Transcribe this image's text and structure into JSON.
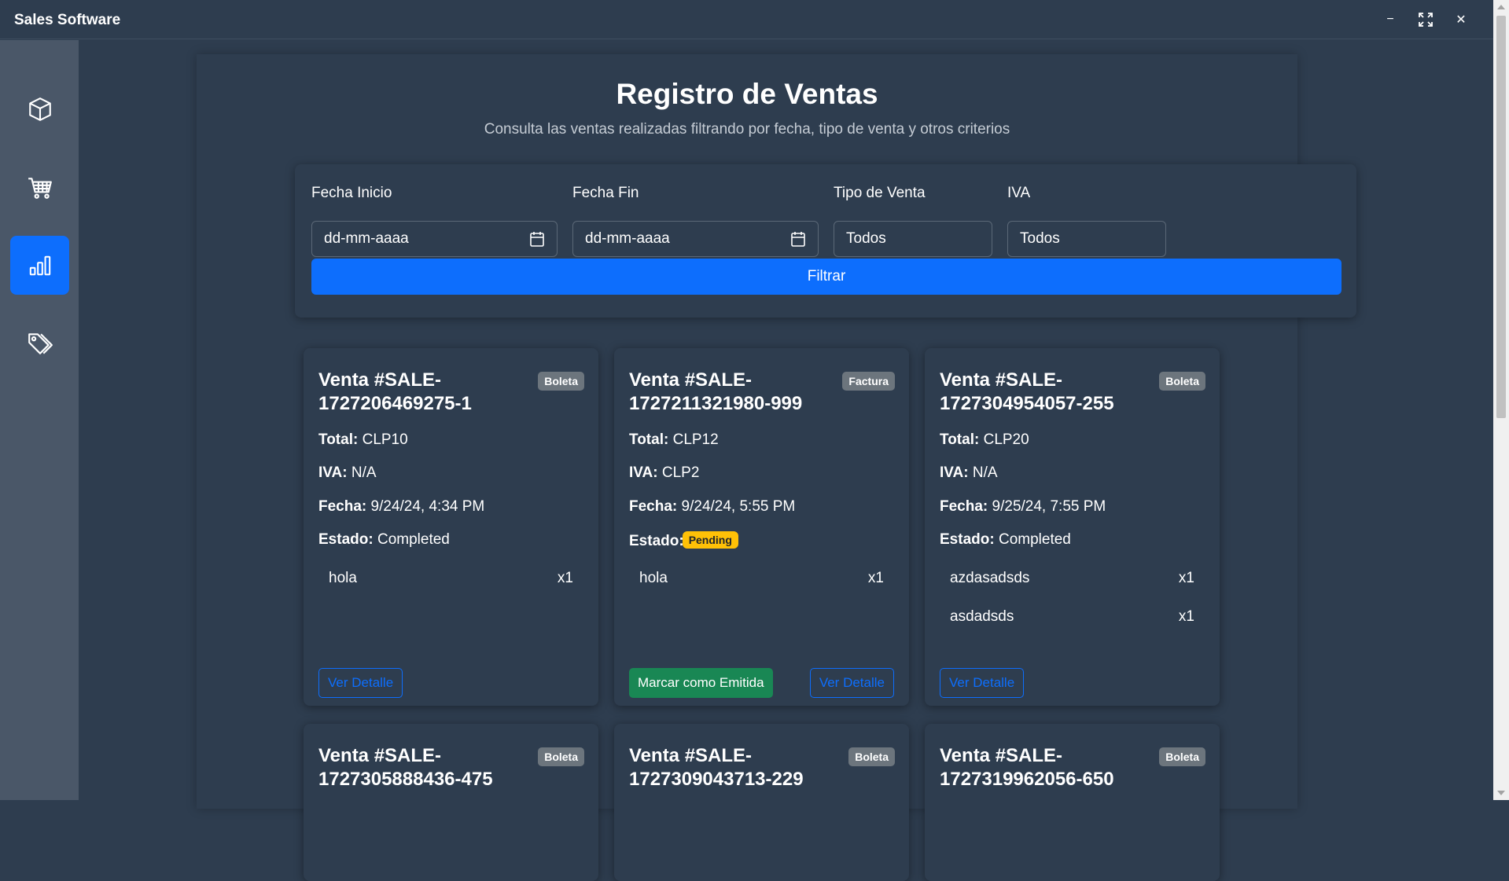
{
  "app": {
    "title": "Sales Software"
  },
  "window_controls": {
    "minimize": "−",
    "maximize": "⛶",
    "close": "✕"
  },
  "sidebar": {
    "items": [
      {
        "name": "products",
        "icon": "box-icon",
        "active": false
      },
      {
        "name": "cart",
        "icon": "cart-icon",
        "active": false
      },
      {
        "name": "reports",
        "icon": "bar-chart-icon",
        "active": true
      },
      {
        "name": "tags",
        "icon": "tags-icon",
        "active": false
      }
    ]
  },
  "header": {
    "title": "Registro de Ventas",
    "subtitle": "Consulta las ventas realizadas filtrando por fecha, tipo de venta y otros criterios"
  },
  "filters": {
    "start_label": "Fecha Inicio",
    "start_value": "dd-mm-aaaa",
    "end_label": "Fecha Fin",
    "end_value": "dd-mm-aaaa",
    "type_label": "Tipo de Venta",
    "type_value": "Todos",
    "iva_label": "IVA",
    "iva_value": "Todos",
    "button": "Filtrar"
  },
  "labels": {
    "total": "Total:",
    "iva": "IVA:",
    "fecha": "Fecha:",
    "estado": "Estado:"
  },
  "sales": [
    {
      "title": "Venta #SALE-1727206469275-1",
      "badge": "Boleta",
      "total": "CLP10",
      "iva": "N/A",
      "fecha": "9/24/24, 4:34 PM",
      "estado": "Completed",
      "items": [
        {
          "name": "hola",
          "qty": "x1"
        }
      ],
      "detail_button": "Ver Detalle"
    },
    {
      "title": "Venta #SALE-1727211321980-999",
      "badge": "Factura",
      "total": "CLP12",
      "iva": "CLP2",
      "fecha": "9/24/24, 5:55 PM",
      "estado": "Pending",
      "items": [
        {
          "name": "hola",
          "qty": "x1"
        }
      ],
      "emit_button": "Marcar como Emitida",
      "detail_button": "Ver Detalle"
    },
    {
      "title": "Venta #SALE-1727304954057-255",
      "badge": "Boleta",
      "total": "CLP20",
      "iva": "N/A",
      "fecha": "9/25/24, 7:55 PM",
      "estado": "Completed",
      "items": [
        {
          "name": "azdasadsds",
          "qty": "x1"
        },
        {
          "name": "asdadsds",
          "qty": "x1"
        }
      ],
      "detail_button": "Ver Detalle"
    },
    {
      "title": "Venta #SALE-1727305888436-475",
      "badge": "Boleta"
    },
    {
      "title": "Venta #SALE-1727309043713-229",
      "badge": "Boleta"
    },
    {
      "title": "Venta #SALE-1727319962056-650",
      "badge": "Boleta"
    }
  ],
  "colors": {
    "primary": "#0d6efd",
    "success": "#198754",
    "warning": "#ffc107",
    "secondary": "#6c757d",
    "background": "#2e3d4f",
    "sidebar": "#4a5768"
  }
}
